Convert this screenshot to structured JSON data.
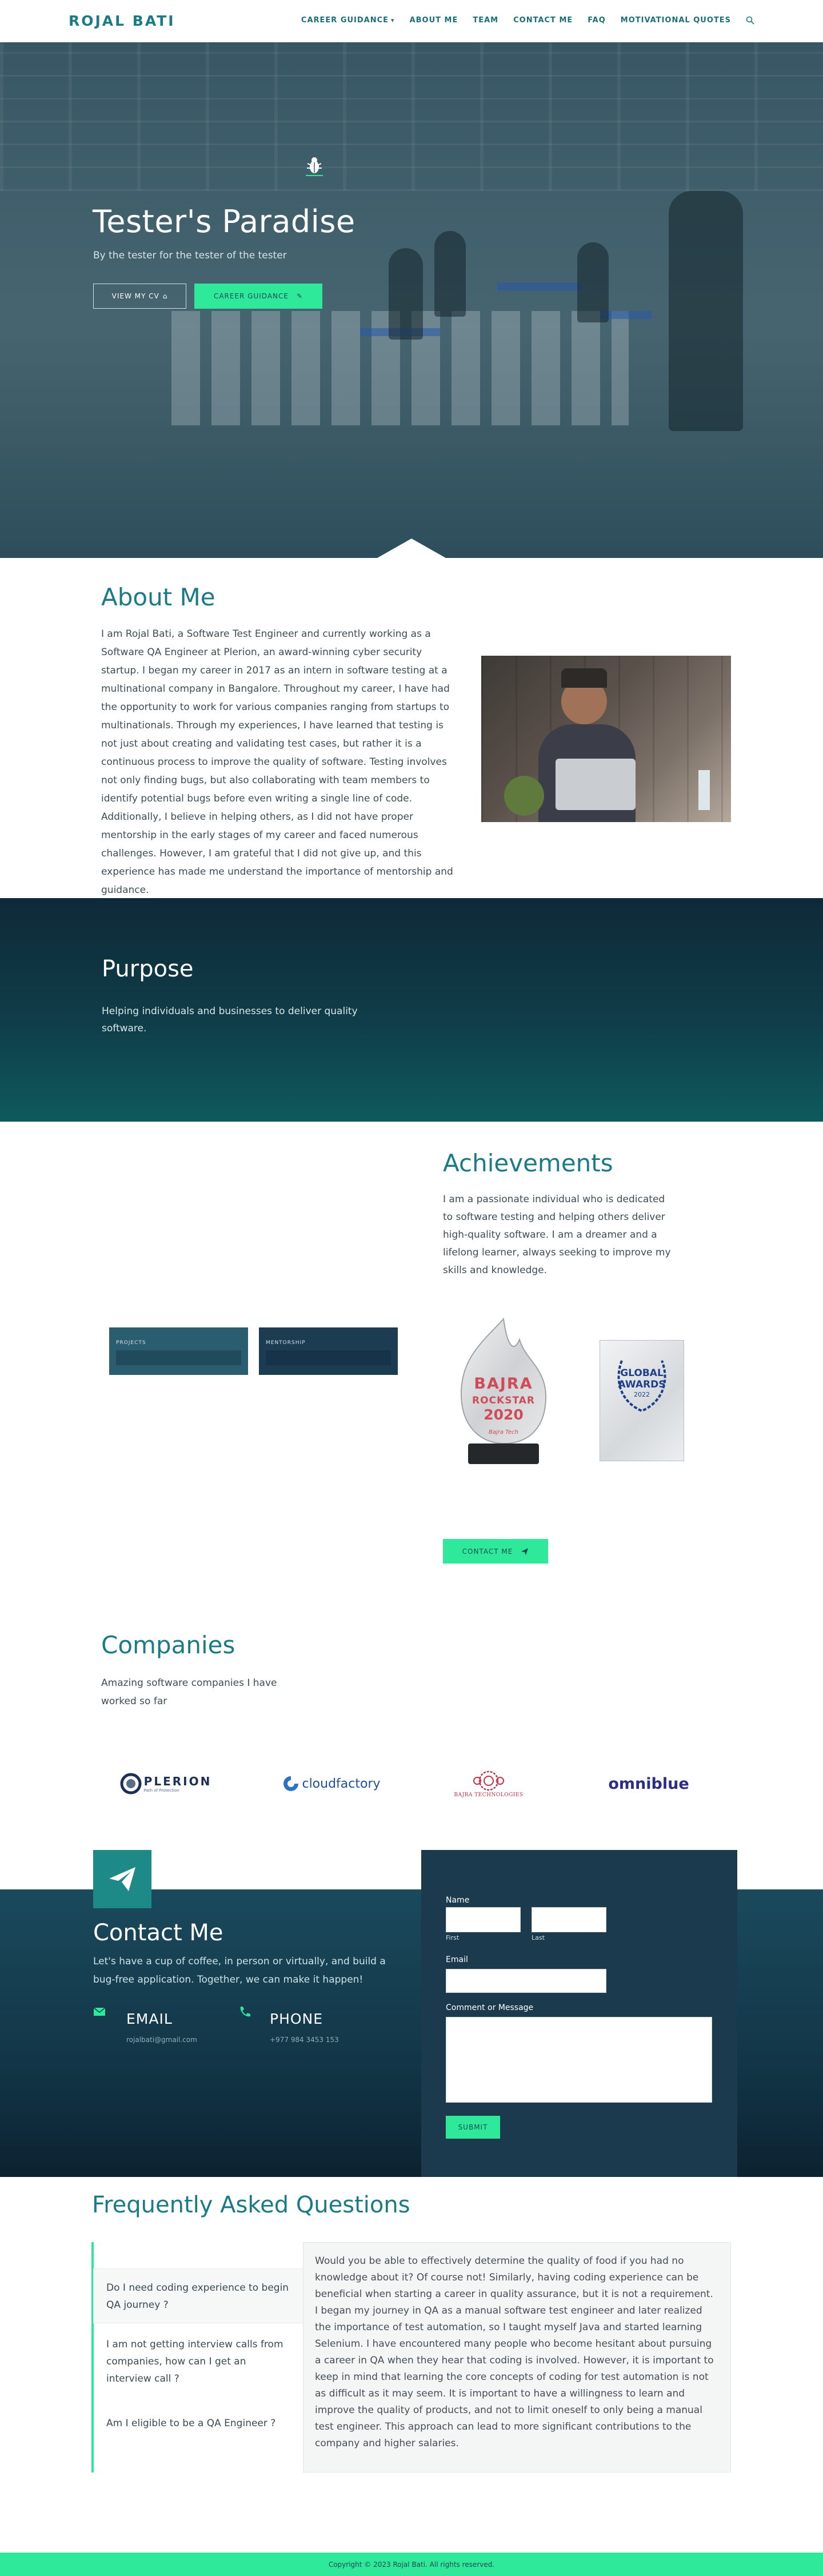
{
  "nav": {
    "brand": "ROJAL BATI",
    "items": [
      {
        "label": "CAREER GUIDANCE",
        "dropdown": true
      },
      {
        "label": "ABOUT ME"
      },
      {
        "label": "TEAM"
      },
      {
        "label": "CONTACT ME"
      },
      {
        "label": "FAQ"
      },
      {
        "label": "MOTIVATIONAL QUOTES"
      }
    ],
    "search_icon": "search-icon"
  },
  "hero": {
    "title": "Tester's Paradise",
    "subtitle": "By the tester for the tester of the tester",
    "btn_cv": "VIEW MY CV",
    "btn_career": "CAREER GUIDANCE",
    "accent": "#2ee99a"
  },
  "about": {
    "title": "About Me",
    "text": "I am Rojal Bati, a Software Test Engineer and currently working as a Software QA Engineer at Plerion, an award-winning cyber security startup. I began my career in 2017 as an intern in software testing at a multinational company in Bangalore. Throughout my career, I have had the opportunity to work for various companies ranging from startups to multinationals. Through my experiences, I have learned that testing is not just about creating and validating test cases, but rather it is a continuous process to improve the quality of software. Testing involves not only finding bugs, but also collaborating with team members to identify potential bugs before even writing a single line of code. Additionally, I believe in helping others, as I did not have proper mentorship in the early stages of my career and faced numerous challenges. However, I am grateful that I did not give up, and this experience has made me understand the importance of mentorship and guidance."
  },
  "purpose": {
    "title": "Purpose",
    "text": "Helping individuals and businesses to deliver quality software."
  },
  "achievements": {
    "title": "Achievements",
    "text": "I am a passionate individual who is dedicated to software testing and helping others deliver high-quality software. I am a dreamer and a lifelong learner, always seeking to improve my skills and knowledge.",
    "stats": [
      {
        "label": "PROJECTS"
      },
      {
        "label": "MENTORSHIP"
      }
    ],
    "award1": {
      "line1": "BAJRA",
      "line2": "ROCKSTAR",
      "line3": "2020",
      "footer": "Bajra Tech"
    },
    "award2": {
      "line1": "GLOBAL",
      "line2": "AWARDS",
      "line3": "2022"
    },
    "btn_contact": "CONTACT ME"
  },
  "companies": {
    "title": "Companies",
    "text": "Amazing software companies I have worked so far",
    "logos": [
      {
        "name": "PLERION",
        "tag": "Path of Protection"
      },
      {
        "name": "cloudfactory"
      },
      {
        "name": "BAJRA TECHNOLOGIES"
      },
      {
        "name": "omniblue"
      }
    ]
  },
  "contact": {
    "title": "Contact Me",
    "subtitle": "Let's have a cup of coffee, in person or virtually, and build a bug-free application. Together, we can make it happen!",
    "email_title": "EMAIL",
    "email_value": "rojalbati@gmail.com",
    "phone_title": "PHONE",
    "phone_value": "+977 984 3453 153",
    "form": {
      "name_label": "Name",
      "first_label": "First",
      "last_label": "Last",
      "email_label": "Email",
      "message_label": "Comment or Message",
      "submit": "SUBMIT"
    }
  },
  "faq": {
    "title": "Frequently Asked Questions",
    "questions": [
      "Do I need coding experience to begin QA journey ?",
      "I am not getting interview calls from companies, how can I get an interview call ?",
      "Am I eligible to be a QA Engineer ?"
    ],
    "answer": "Would you be able to effectively determine the quality of food if you had no knowledge about it? Of course not! Similarly, having coding experience can be beneficial when starting a career in quality assurance, but it is not a requirement. I began my journey in QA as a manual software test engineer and later realized the importance of test automation, so I taught myself Java and started learning Selenium. I have encountered many people who become hesitant about pursuing a career in QA when they hear that coding is involved. However, it is important to keep in mind that learning the core concepts of coding for test automation is not as difficult as it may seem. It is important to have a willingness to learn and improve the quality of products, and not to limit oneself to only being a manual test engineer. This approach can lead to more significant contributions to the company and higher salaries."
  },
  "footer": {
    "text": "Copyright © 2023 Rojal Bati. All rights reserved."
  }
}
